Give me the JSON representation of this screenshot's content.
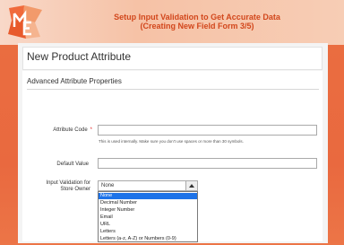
{
  "header": {
    "title_line1": "Setup Input Validation to Get Accurate Data",
    "title_line2": "(Creating New Field Form 3/5)"
  },
  "page": {
    "title": "New Product Attribute"
  },
  "section": {
    "title": "Advanced Attribute Properties"
  },
  "form": {
    "attribute_code_label": "Attribute Code",
    "attribute_code_required": "*",
    "attribute_code_note": "This is used internally. Make sure you don't use spaces or more than 30 symbols.",
    "default_value_label": "Default Value",
    "input_validation_label_line1": "Input Validation for",
    "input_validation_label_line2": "Store Owner",
    "input_validation_selected": "None",
    "input_validation_options": [
      "None",
      "Decimal Number",
      "Integer Number",
      "Email",
      "URL",
      "Letters",
      "Letters (a-z, A-Z) or Numbers (0-9)"
    ]
  },
  "colors": {
    "accent": "#e9693f",
    "header_text": "#d2471c",
    "selected_option": "#1e73e8"
  }
}
